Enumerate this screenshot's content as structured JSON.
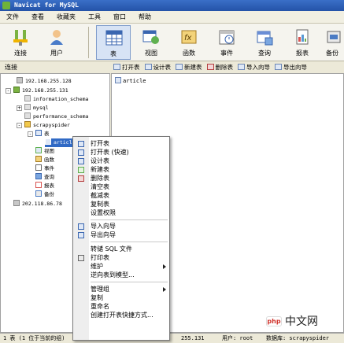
{
  "window": {
    "title": "Navicat for MySQL"
  },
  "menubar": {
    "items": [
      "文件",
      "查看",
      "收藏夹",
      "工具",
      "窗口",
      "帮助"
    ]
  },
  "toolbar": {
    "buttons": [
      {
        "label": "连接",
        "icon": "connect-icon"
      },
      {
        "label": "用户",
        "icon": "user-icon"
      },
      {
        "label": "表",
        "icon": "table-icon",
        "active": true
      },
      {
        "label": "视图",
        "icon": "view-icon"
      },
      {
        "label": "函数",
        "icon": "function-icon"
      },
      {
        "label": "事件",
        "icon": "event-icon"
      },
      {
        "label": "查询",
        "icon": "query-icon"
      },
      {
        "label": "报表",
        "icon": "report-icon"
      },
      {
        "label": "备份",
        "icon": "backup-icon"
      }
    ]
  },
  "sidebar": {
    "header": "连接",
    "tree": [
      {
        "label": "192.168.255.128",
        "icon": "server-icon"
      },
      {
        "label": "192.168.255.131",
        "icon": "server-icon"
      },
      {
        "label": "information_schema",
        "icon": "database-icon"
      },
      {
        "label": "mysql",
        "icon": "database-icon"
      },
      {
        "label": "performance_schema",
        "icon": "database-icon"
      },
      {
        "label": "scrapyspider",
        "icon": "database-icon"
      },
      {
        "label": "表",
        "icon": "table-folder-icon"
      },
      {
        "label": "article",
        "icon": "table-icon"
      },
      {
        "label": "视图",
        "icon": "view-icon"
      },
      {
        "label": "函数",
        "icon": "function-icon"
      },
      {
        "label": "事件",
        "icon": "event-icon"
      },
      {
        "label": "查询",
        "icon": "query-icon"
      },
      {
        "label": "报表",
        "icon": "report-icon"
      },
      {
        "label": "备份",
        "icon": "backup-icon"
      },
      {
        "label": "202.118.86.78",
        "icon": "server-icon"
      }
    ]
  },
  "objectbar": {
    "items": [
      "打开表",
      "设计表",
      "新建表",
      "删除表",
      "导入向导",
      "导出向导"
    ]
  },
  "content": {
    "tables": [
      "article"
    ]
  },
  "context_menu": {
    "items": [
      "打开表",
      "打开表 (快速)",
      "设计表",
      "新建表",
      "删除表",
      "清空表",
      "截减表",
      "复制表",
      "设置权限",
      "导入向导",
      "导出向导",
      "转储 SQL 文件",
      "打印表",
      "维护",
      "逆向表到模型...",
      "管理组",
      "复制",
      "重命名",
      "创建打开表快捷方式..."
    ]
  },
  "statusbar": {
    "left": "1 表 (1 位于当前的组)",
    "server": "255.131",
    "user": "用户: root",
    "database": "数据库: scrapyspider"
  },
  "watermark": {
    "logo": "php",
    "text": "中文网"
  },
  "colors": {
    "selection": "#316ac5",
    "titlebar": "#2453a8",
    "accent_green": "#6fb23a"
  }
}
